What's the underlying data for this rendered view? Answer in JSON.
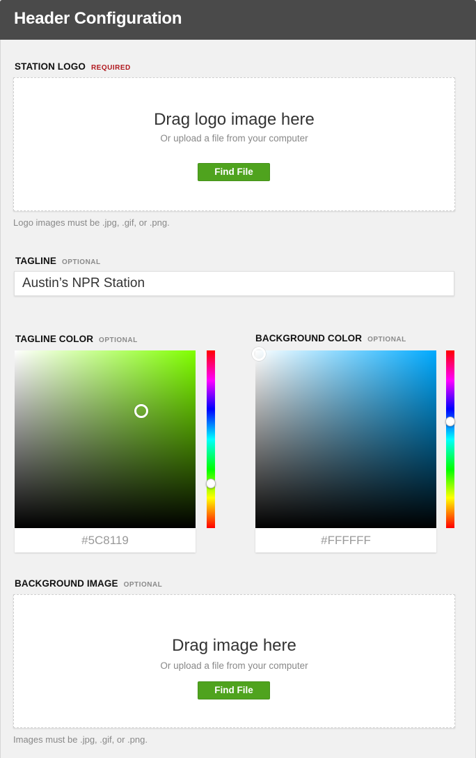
{
  "header": {
    "title": "Header Configuration"
  },
  "station_logo": {
    "label": "STATION LOGO",
    "tag": "REQUIRED",
    "drop_title": "Drag logo image here",
    "drop_subtitle": "Or upload a file from your computer",
    "button_label": "Find File",
    "hint": "Logo images must be .jpg, .gif, or .png."
  },
  "tagline": {
    "label": "TAGLINE",
    "tag": "OPTIONAL",
    "value": "Austin’s NPR Station"
  },
  "tagline_color": {
    "label": "TAGLINE COLOR",
    "tag": "OPTIONAL",
    "hue_color": "#80ff00",
    "saturation": 0.7,
    "brightness": 0.66,
    "hue_position": 0.75,
    "hex_value": "#5C8119"
  },
  "background_color": {
    "label": "BACKGROUND COLOR",
    "tag": "OPTIONAL",
    "hue_color": "#00aaff",
    "saturation": 0.02,
    "brightness": 0.98,
    "hue_position": 0.4,
    "hex_value": "#FFFFFF"
  },
  "background_image": {
    "label": "BACKGROUND IMAGE",
    "tag": "OPTIONAL",
    "drop_title": "Drag image here",
    "drop_subtitle": "Or upload a file from your computer",
    "button_label": "Find File",
    "hint": "Images must be .jpg, .gif, or .png."
  }
}
